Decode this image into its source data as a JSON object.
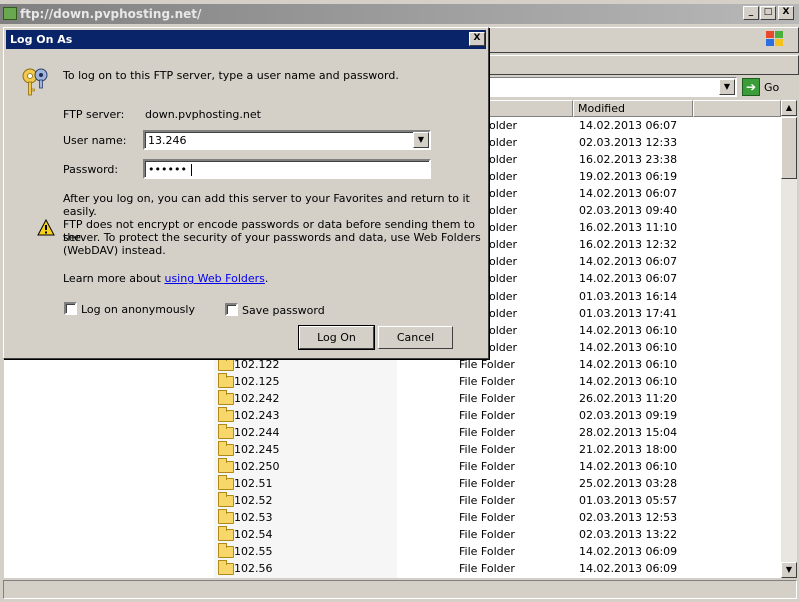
{
  "window": {
    "title": "ftp://down.pvphosting.net/",
    "min_glyph": "_",
    "max_glyph": "□",
    "close_glyph": "X"
  },
  "address_bar": {
    "go_label": "Go"
  },
  "columns": {
    "modified": "Modified"
  },
  "list_rows": [
    {
      "name": "",
      "type": "older",
      "modified": "14.02.2013 06:07"
    },
    {
      "name": "",
      "type": "older",
      "modified": "02.03.2013 12:33"
    },
    {
      "name": "",
      "type": "older",
      "modified": "16.02.2013 23:38"
    },
    {
      "name": "",
      "type": "older",
      "modified": "19.02.2013 06:19"
    },
    {
      "name": "",
      "type": "older",
      "modified": "14.02.2013 06:07"
    },
    {
      "name": "",
      "type": "older",
      "modified": "02.03.2013 09:40"
    },
    {
      "name": "",
      "type": "older",
      "modified": "16.02.2013 11:10"
    },
    {
      "name": "",
      "type": "older",
      "modified": "16.02.2013 12:32"
    },
    {
      "name": "",
      "type": "older",
      "modified": "14.02.2013 06:07"
    },
    {
      "name": "",
      "type": "older",
      "modified": "14.02.2013 06:07"
    },
    {
      "name": "",
      "type": "older",
      "modified": "01.03.2013 16:14"
    },
    {
      "name": "",
      "type": "older",
      "modified": "01.03.2013 17:41"
    },
    {
      "name": "",
      "type": "older",
      "modified": "14.02.2013 06:10"
    },
    {
      "name": "",
      "type": "older",
      "modified": "14.02.2013 06:10"
    },
    {
      "name": "102.122",
      "type": "File Folder",
      "modified": "14.02.2013 06:10"
    },
    {
      "name": "102.125",
      "type": "File Folder",
      "modified": "14.02.2013 06:10"
    },
    {
      "name": "102.242",
      "type": "File Folder",
      "modified": "26.02.2013 11:20"
    },
    {
      "name": "102.243",
      "type": "File Folder",
      "modified": "02.03.2013 09:19"
    },
    {
      "name": "102.244",
      "type": "File Folder",
      "modified": "28.02.2013 15:04"
    },
    {
      "name": "102.245",
      "type": "File Folder",
      "modified": "21.02.2013 18:00"
    },
    {
      "name": "102.250",
      "type": "File Folder",
      "modified": "14.02.2013 06:10"
    },
    {
      "name": "102.51",
      "type": "File Folder",
      "modified": "25.02.2013 03:28"
    },
    {
      "name": "102.52",
      "type": "File Folder",
      "modified": "01.03.2013 05:57"
    },
    {
      "name": "102.53",
      "type": "File Folder",
      "modified": "02.03.2013 12:53"
    },
    {
      "name": "102.54",
      "type": "File Folder",
      "modified": "02.03.2013 13:22"
    },
    {
      "name": "102.55",
      "type": "File Folder",
      "modified": "14.02.2013 06:09"
    },
    {
      "name": "102.56",
      "type": "File Folder",
      "modified": "14.02.2013 06:09"
    }
  ],
  "dialog": {
    "title": "Log On As",
    "close_glyph": "X",
    "intro": "To log on to this FTP server, type a user name and password.",
    "server_label": "FTP server:",
    "server_value": "down.pvphosting.net",
    "user_label": "User name:",
    "user_value": "13.246",
    "password_label": "Password:",
    "password_value": "••••••",
    "after_text": "After you log on, you can add this server to your Favorites and return to it easily.",
    "warning_line1": "FTP does not encrypt or encode passwords or data before sending them to the",
    "warning_line2": "server.  To protect the security of your passwords and data, use Web Folders",
    "warning_line3": "(WebDAV) instead.",
    "learn_prefix": "Learn more about ",
    "learn_link": "using Web Folders",
    "learn_suffix": ".",
    "anon_label": "Log on anonymously",
    "save_label": "Save password",
    "logon_button": "Log On",
    "cancel_button": "Cancel"
  }
}
